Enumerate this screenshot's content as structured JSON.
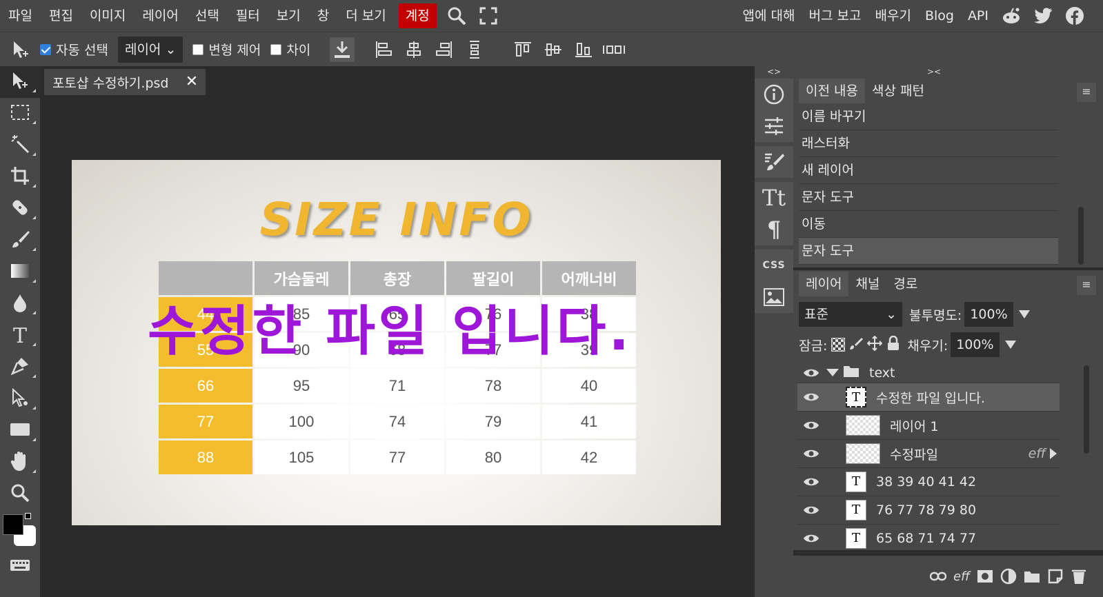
{
  "menu": {
    "items": [
      "파일",
      "편집",
      "이미지",
      "레이어",
      "선택",
      "필터",
      "보기",
      "창",
      "더 보기",
      "계정"
    ],
    "active_index": 9,
    "right_links": [
      "앱에 대해",
      "버그 보고",
      "배우기",
      "Blog",
      "API"
    ]
  },
  "options": {
    "auto_select_label": "자동 선택",
    "auto_select_checked": true,
    "target_value": "레이어",
    "transform_label": "변형 제어",
    "distance_label": "차이"
  },
  "doc": {
    "tab_title": "포토샵 수정하기.psd",
    "close_glyph": "✕"
  },
  "canvas": {
    "title": "SIZE INFO",
    "overlay": "수정한 파일 입니다.",
    "headers": [
      "",
      "가슴둘레",
      "총장",
      "팔길이",
      "어깨너비"
    ],
    "rows": [
      [
        "44",
        "85",
        "65",
        "76",
        "38"
      ],
      [
        "55",
        "90",
        "68",
        "77",
        "39"
      ],
      [
        "66",
        "95",
        "71",
        "78",
        "40"
      ],
      [
        "77",
        "100",
        "74",
        "79",
        "41"
      ],
      [
        "88",
        "105",
        "77",
        "80",
        "42"
      ]
    ]
  },
  "minibar": {
    "arrows": "<>",
    "css_label": "CSS"
  },
  "history_panel": {
    "arrows": "><",
    "tabs": [
      "이전 내용",
      "색상 패턴"
    ],
    "menu_glyph": "≡",
    "items": [
      "이름 바꾸기",
      "래스터화",
      "새 레이어",
      "문자 도구",
      "이동",
      "문자 도구"
    ]
  },
  "layers_panel": {
    "tabs": [
      "레이어",
      "채널",
      "경로"
    ],
    "menu_glyph": "≡",
    "blend_mode": "표준",
    "opacity_label": "불투명도:",
    "opacity_value": "100%",
    "lock_label": "잠금:",
    "fill_label": "채우기:",
    "fill_value": "100%",
    "layers": [
      {
        "name": "text",
        "kind": "folder"
      },
      {
        "name": "수정한 파일 입니다.",
        "kind": "text-selected"
      },
      {
        "name": "레이어 1",
        "kind": "raster"
      },
      {
        "name": "수정파일",
        "kind": "raster",
        "badge": "eff"
      },
      {
        "name": "38 39 40 41 42",
        "kind": "text"
      },
      {
        "name": "76 77 78 79 80",
        "kind": "text"
      },
      {
        "name": "65 68 71 74 77",
        "kind": "text"
      }
    ],
    "bottom_eff": "eff"
  },
  "colors": {
    "accent_menu": "#c30000",
    "overlay_text": "#9e16d8",
    "table_header_yellow": "#f3bd2e",
    "title_yellow": "#f0b62f"
  }
}
